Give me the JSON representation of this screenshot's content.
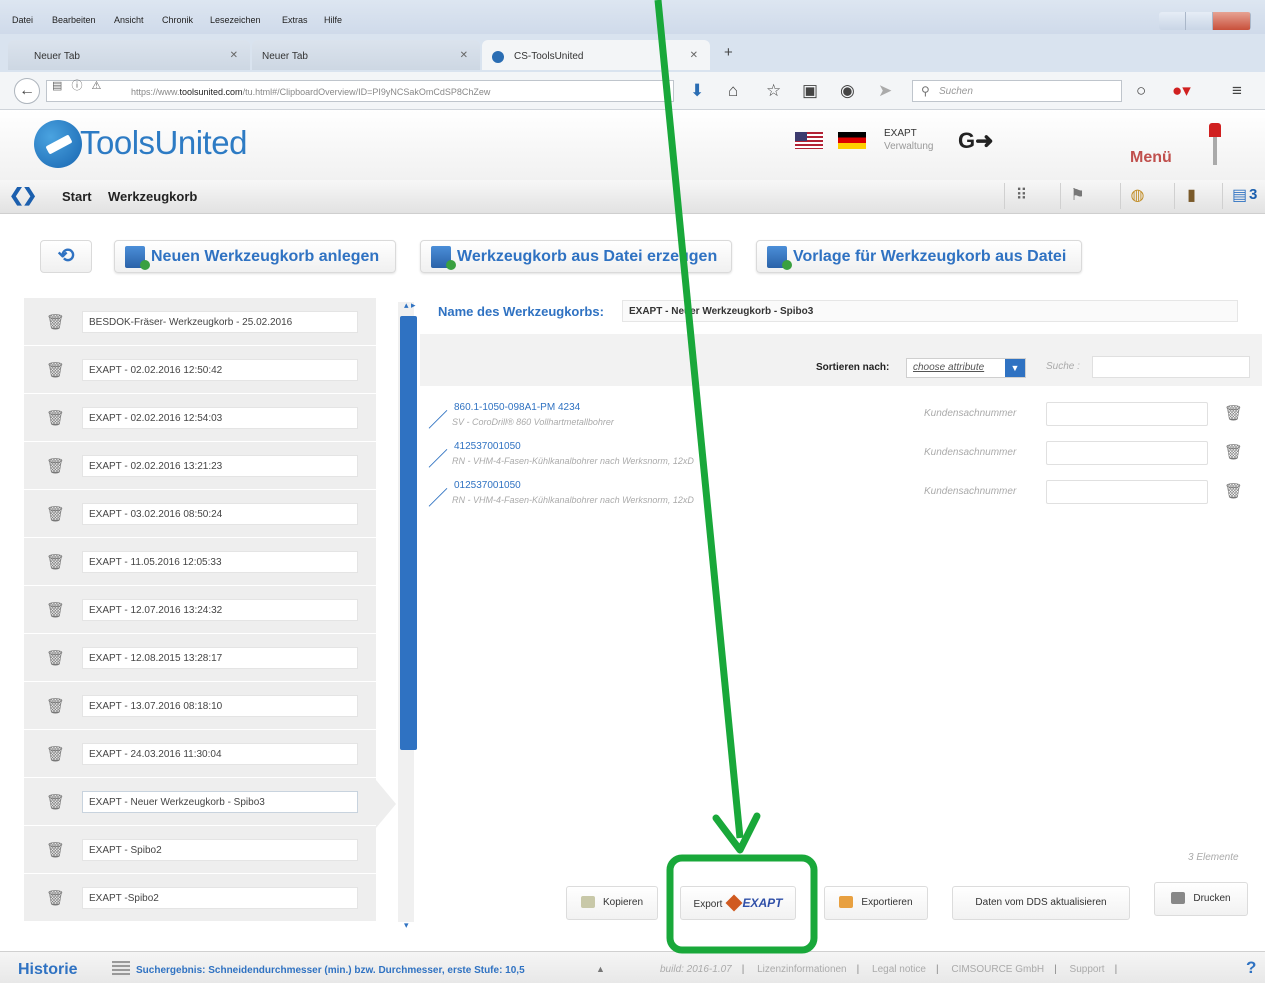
{
  "browser": {
    "menu": [
      "Datei",
      "Bearbeiten",
      "Ansicht",
      "Chronik",
      "Lesezeichen",
      "Extras",
      "Hilfe"
    ],
    "tabs": [
      {
        "label": "Neuer Tab"
      },
      {
        "label": "Neuer Tab"
      },
      {
        "label": "CS-ToolsUnited"
      }
    ],
    "url_prefix": "https://www.",
    "url_host": "toolsunited.com",
    "url_path": "/tu.html#/ClipboardOverview/ID=PI9yNCSakOmCdSP8ChZew",
    "search_placeholder": "Suchen"
  },
  "header": {
    "logo": "ToolsUnited",
    "exapt_title": "EXAPT",
    "exapt_sub": "Verwaltung",
    "menu_label": "Menü"
  },
  "breadcrumb": {
    "home": "Start",
    "current": "Werkzeugkorb",
    "cart_count": "3"
  },
  "actions": {
    "new_cart": "Neuen Werkzeugkorb anlegen",
    "from_file": "Werkzeugkorb aus Datei erzeugen",
    "template": "Vorlage für Werkzeugkorb aus Datei"
  },
  "carts": [
    "BESDOK-Fräser- Werkzeugkorb - 25.02.2016",
    "EXAPT - 02.02.2016 12:50:42",
    "EXAPT - 02.02.2016 12:54:03",
    "EXAPT - 02.02.2016 13:21:23",
    "EXAPT - 03.02.2016 08:50:24",
    "EXAPT - 11.05.2016 12:05:33",
    "EXAPT - 12.07.2016 13:24:32",
    "EXAPT - 12.08.2015 13:28:17",
    "EXAPT - 13.07.2016 08:18:10",
    "EXAPT - 24.03.2016 11:30:04",
    "EXAPT - Neuer Werkzeugkorb - Spibo3",
    "EXAPT - Spibo2",
    "EXAPT -Spibo2"
  ],
  "detail": {
    "name_label": "Name des Werkzeugkorbs:",
    "name_value": "EXAPT - Neuer Werkzeugkorb - Spibo3",
    "sort_label": "Sortieren nach:",
    "sort_value": "choose attribute",
    "search_label": "Suche :",
    "items": [
      {
        "code": "860.1-1050-098A1-PM 4234",
        "desc": "SV  -  CoroDrill® 860 Vollhartmetallbohrer",
        "ks_label": "Kundensachnummer"
      },
      {
        "code": "412537001050",
        "desc": "RN  -  VHM-4-Fasen-Kühlkanalbohrer nach Werksnorm, 12xD",
        "ks_label": "Kundensachnummer"
      },
      {
        "code": "012537001050",
        "desc": "RN  -  VHM-4-Fasen-Kühlkanalbohrer nach Werksnorm, 12xD",
        "ks_label": "Kundensachnummer"
      }
    ],
    "count": "3  Elemente"
  },
  "bottom_buttons": {
    "copy": "Kopieren",
    "export": "Export",
    "export_logo": "EXAPT",
    "exportieren": "Exportieren",
    "update": "Daten vom DDS aktualisieren",
    "print": "Drucken"
  },
  "status": {
    "history": "Historie",
    "history_text": "Suchergebnis: Schneidendurchmesser (min.) bzw. Durchmesser, erste Stufe: 10,5",
    "build": "build: 2016-1.07",
    "links": [
      "Lizenzinformationen",
      "Legal notice",
      "CIMSOURCE GmbH",
      "Support"
    ],
    "help": "?"
  },
  "colors": {
    "brand_blue": "#2f72c2",
    "annotation_green": "#19a83a"
  }
}
